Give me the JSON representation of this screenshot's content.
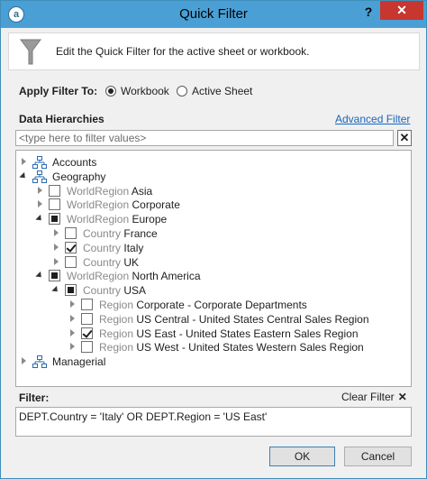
{
  "window": {
    "title": "Quick Filter",
    "help_glyph": "?",
    "close_glyph": "✕",
    "app_icon_letter": "a"
  },
  "header": {
    "description": "Edit the Quick Filter for the active sheet or workbook.",
    "icon": "funnel-icon"
  },
  "apply_filter": {
    "label": "Apply Filter To:",
    "options": [
      {
        "label": "Workbook",
        "selected": true
      },
      {
        "label": "Active Sheet",
        "selected": false
      }
    ]
  },
  "hierarchies": {
    "title": "Data Hierarchies",
    "advanced_link": "Advanced Filter",
    "search_placeholder": "<type here to filter values>",
    "clear_glyph": "✕",
    "tree": [
      {
        "level": "",
        "name": "Accounts",
        "depth": 0,
        "expanded": false,
        "check": "none",
        "icon": "hierarchy-icon"
      },
      {
        "level": "",
        "name": "Geography",
        "depth": 0,
        "expanded": true,
        "check": "none",
        "icon": "hierarchy-icon"
      },
      {
        "level": "WorldRegion",
        "name": "Asia",
        "depth": 1,
        "expanded": false,
        "check": "unchecked"
      },
      {
        "level": "WorldRegion",
        "name": "Corporate",
        "depth": 1,
        "expanded": false,
        "check": "unchecked"
      },
      {
        "level": "WorldRegion",
        "name": "Europe",
        "depth": 1,
        "expanded": true,
        "check": "partial"
      },
      {
        "level": "Country",
        "name": "France",
        "depth": 2,
        "expanded": false,
        "check": "unchecked"
      },
      {
        "level": "Country",
        "name": "Italy",
        "depth": 2,
        "expanded": false,
        "check": "checked"
      },
      {
        "level": "Country",
        "name": "UK",
        "depth": 2,
        "expanded": false,
        "check": "unchecked"
      },
      {
        "level": "WorldRegion",
        "name": "North America",
        "depth": 1,
        "expanded": true,
        "check": "partial"
      },
      {
        "level": "Country",
        "name": "USA",
        "depth": 2,
        "expanded": true,
        "check": "partial"
      },
      {
        "level": "Region",
        "name": "Corporate - Corporate Departments",
        "depth": 3,
        "expanded": false,
        "check": "unchecked"
      },
      {
        "level": "Region",
        "name": "US Central - United States Central Sales Region",
        "depth": 3,
        "expanded": false,
        "check": "unchecked"
      },
      {
        "level": "Region",
        "name": "US East - United States Eastern Sales Region",
        "depth": 3,
        "expanded": false,
        "check": "checked"
      },
      {
        "level": "Region",
        "name": "US West - United States Western Sales Region",
        "depth": 3,
        "expanded": false,
        "check": "unchecked"
      },
      {
        "level": "",
        "name": "Managerial",
        "depth": 0,
        "expanded": false,
        "check": "none",
        "icon": "hierarchy-icon"
      }
    ]
  },
  "filter": {
    "label": "Filter:",
    "clear_label": "Clear Filter",
    "clear_glyph": "✕",
    "expression": "DEPT.Country = 'Italy' OR DEPT.Region = 'US East'"
  },
  "buttons": {
    "ok": "OK",
    "cancel": "Cancel"
  },
  "colors": {
    "titlebar": "#4aa0d5",
    "close": "#c7372f",
    "link": "#1a66b8",
    "level_text": "#8a8a8a"
  }
}
